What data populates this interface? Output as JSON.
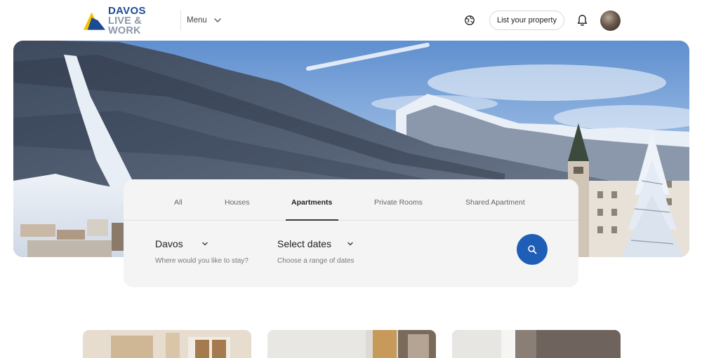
{
  "header": {
    "logo_line1": "DAVOS",
    "logo_line2": "LIVE & WORK",
    "menu_label": "Menu",
    "list_property_label": "List your property"
  },
  "search": {
    "tabs": [
      {
        "label": "All",
        "active": false
      },
      {
        "label": "Houses",
        "active": false
      },
      {
        "label": "Apartments",
        "active": true
      },
      {
        "label": "Private Rooms",
        "active": false
      },
      {
        "label": "Shared Apartment",
        "active": false
      }
    ],
    "location_value": "Davos",
    "location_hint": "Where would you like to stay?",
    "dates_value": "Select dates",
    "dates_hint": "Choose a range of dates"
  },
  "colors": {
    "brand_blue": "#1d4b93",
    "brand_yellow": "#f2c400",
    "search_button": "#1f5eb6"
  },
  "icons": [
    "chevron-down-icon",
    "globe-icon",
    "bell-icon",
    "search-icon"
  ]
}
